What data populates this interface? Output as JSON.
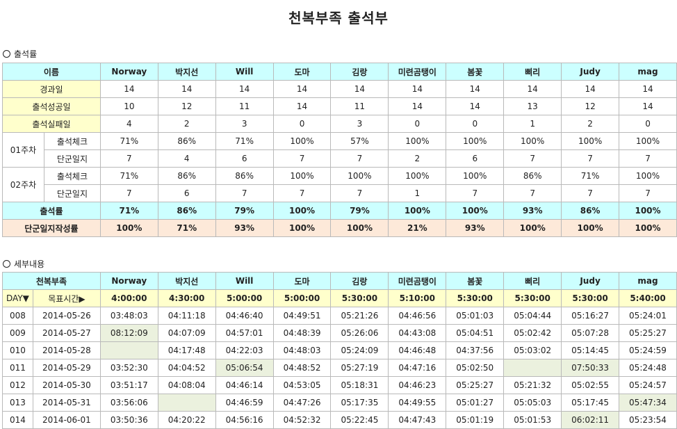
{
  "page": {
    "title": "천복부족 출석부"
  },
  "attendance": {
    "section_label": "출석률",
    "name_header": "이름",
    "members": [
      "Norway",
      "박지선",
      "Will",
      "도마",
      "김랑",
      "미련곰탱이",
      "봄꽃",
      "삐리",
      "Judy",
      "mag"
    ],
    "rows": [
      {
        "label": "경과일",
        "values": [
          "14",
          "14",
          "14",
          "14",
          "14",
          "14",
          "14",
          "14",
          "14",
          "14"
        ]
      },
      {
        "label": "출석성공일",
        "values": [
          "10",
          "12",
          "11",
          "14",
          "11",
          "14",
          "14",
          "13",
          "12",
          "14"
        ]
      },
      {
        "label": "출석실패일",
        "values": [
          "4",
          "2",
          "3",
          "0",
          "3",
          "0",
          "0",
          "1",
          "2",
          "0"
        ]
      }
    ],
    "weeks": [
      {
        "label": "01주차",
        "check_label": "출석체크",
        "check": [
          "71%",
          "86%",
          "71%",
          "100%",
          "57%",
          "100%",
          "100%",
          "100%",
          "100%",
          "100%"
        ],
        "journal_label": "단군일지",
        "journal": [
          "7",
          "4",
          "6",
          "7",
          "7",
          "2",
          "6",
          "7",
          "7",
          "7"
        ]
      },
      {
        "label": "02주차",
        "check_label": "출석체크",
        "check": [
          "71%",
          "86%",
          "86%",
          "100%",
          "100%",
          "100%",
          "100%",
          "86%",
          "71%",
          "100%"
        ],
        "journal_label": "단군일지",
        "journal": [
          "7",
          "6",
          "7",
          "7",
          "7",
          "1",
          "7",
          "7",
          "7",
          "7"
        ]
      }
    ],
    "rate": {
      "label": "출석률",
      "values": [
        "71%",
        "86%",
        "79%",
        "100%",
        "79%",
        "100%",
        "100%",
        "93%",
        "86%",
        "100%"
      ]
    },
    "journal_rate": {
      "label": "단군일지작성률",
      "values": [
        "100%",
        "71%",
        "93%",
        "100%",
        "100%",
        "21%",
        "93%",
        "100%",
        "100%",
        "100%"
      ]
    }
  },
  "details": {
    "section_label": "세부내용",
    "tribe_label": "천복부족",
    "day_label": "DAY▼",
    "target_label": "목표시간▶",
    "targets": [
      "4:00:00",
      "4:30:00",
      "5:00:00",
      "5:00:00",
      "5:30:00",
      "5:10:00",
      "5:30:00",
      "5:30:00",
      "5:30:00",
      "5:40:00"
    ],
    "rows": [
      {
        "day": "008",
        "date": "2014-05-26",
        "times": [
          "03:48:03",
          "04:11:18",
          "04:46:40",
          "04:49:51",
          "05:21:26",
          "04:46:56",
          "05:01:03",
          "05:04:44",
          "05:16:27",
          "05:24:01"
        ]
      },
      {
        "day": "009",
        "date": "2014-05-27",
        "times": [
          "08:12:09",
          "04:07:09",
          "04:57:01",
          "04:48:39",
          "05:26:06",
          "04:43:08",
          "05:04:51",
          "05:02:42",
          "05:07:28",
          "05:25:27"
        ]
      },
      {
        "day": "010",
        "date": "2014-05-28",
        "times": [
          "",
          "04:17:48",
          "04:22:03",
          "04:48:03",
          "05:24:09",
          "04:46:48",
          "04:37:56",
          "05:03:02",
          "05:14:45",
          "05:24:59"
        ]
      },
      {
        "day": "011",
        "date": "2014-05-29",
        "times": [
          "03:52:30",
          "04:04:52",
          "05:06:54",
          "04:48:52",
          "05:27:19",
          "04:47:16",
          "05:02:50",
          "",
          "07:50:33",
          "05:24:48"
        ]
      },
      {
        "day": "012",
        "date": "2014-05-30",
        "times": [
          "03:51:17",
          "04:08:04",
          "04:46:14",
          "04:53:05",
          "05:18:31",
          "04:46:23",
          "05:25:27",
          "05:21:32",
          "05:02:55",
          "05:24:57"
        ]
      },
      {
        "day": "013",
        "date": "2014-05-31",
        "times": [
          "03:56:06",
          "",
          "04:46:59",
          "04:47:26",
          "05:17:35",
          "04:49:55",
          "05:01:27",
          "05:05:03",
          "05:17:45",
          "05:47:34"
        ]
      },
      {
        "day": "014",
        "date": "2014-06-01",
        "times": [
          "03:50:36",
          "04:20:22",
          "04:56:16",
          "04:52:32",
          "05:22:45",
          "04:47:43",
          "05:01:19",
          "05:01:53",
          "06:02:11",
          "05:23:54"
        ]
      }
    ],
    "highlight_color": "#ebf1de"
  },
  "colors": {
    "header_cyan": "#ccffff",
    "label_yellow": "#ffffcc",
    "journal_peach": "#fde9d9",
    "border": "#b9b9b9"
  }
}
